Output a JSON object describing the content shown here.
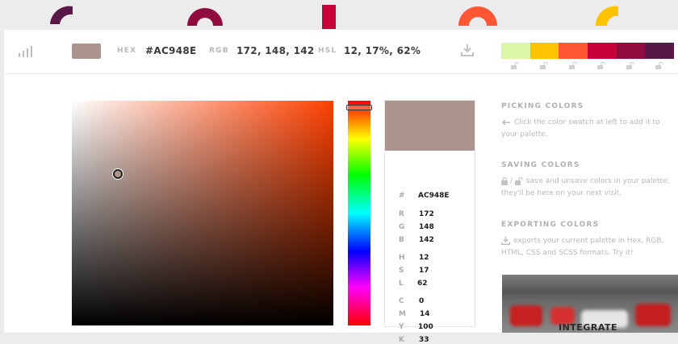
{
  "current": {
    "swatch_color": "#AC948E",
    "hex_label": "HEX",
    "hex_value": "#AC948E",
    "rgb_label": "RGB",
    "rgb_value": "172, 148, 142",
    "hsl_label": "HSL",
    "hsl_value": "12, 17%, 62%"
  },
  "palette_colors": [
    "#DAF7A6",
    "#FFC300",
    "#FF5733",
    "#C70039",
    "#900C3F",
    "#581845"
  ],
  "top_deco_colors": [
    "#581845",
    "#900C3F",
    "#C70039",
    "#FF5733",
    "#FFC300"
  ],
  "details": {
    "hash": "#",
    "hex": "AC948E",
    "rows": [
      {
        "key": "R",
        "value": "172"
      },
      {
        "key": "G",
        "value": "148"
      },
      {
        "key": "B",
        "value": "142"
      },
      {
        "key": "H",
        "value": "12"
      },
      {
        "key": "S",
        "value": "17"
      },
      {
        "key": "L",
        "value": "62"
      },
      {
        "key": "C",
        "value": "0"
      },
      {
        "key": "M",
        "value": "14"
      },
      {
        "key": "Y",
        "value": "100"
      },
      {
        "key": "K",
        "value": "33"
      }
    ]
  },
  "help": {
    "picking_title": "PICKING COLORS",
    "picking_text": "Click the color swatch at left to add it to your palette.",
    "saving_title": "SAVING COLORS",
    "saving_text": "save and unsave colors in your palette; they'll be here on your next visit.",
    "saving_slash": "/",
    "exporting_title": "EXPORTING COLORS",
    "exporting_text": "exports your current palette in Hex, RGB, HTML, CSS and SCSS formats. Try it!"
  },
  "ad": {
    "text": "INTEGRATE"
  },
  "icons": {
    "bars": "bar-chart-icon",
    "download": "download-icon",
    "lock": "lock-icon",
    "arrow": "arrow-left-icon"
  }
}
